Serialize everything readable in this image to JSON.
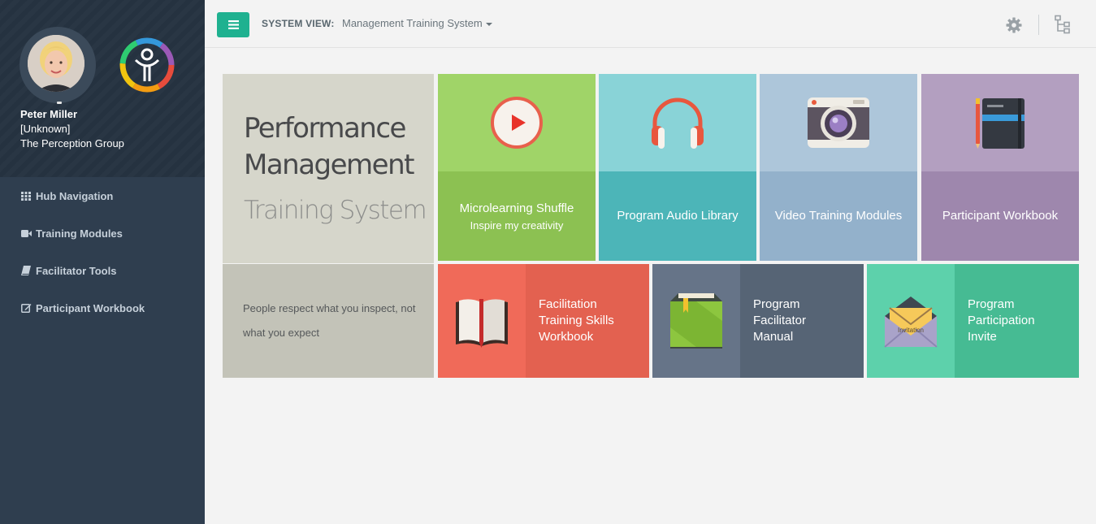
{
  "profile": {
    "name": "Peter Miller",
    "role": "[Unknown]",
    "organization": "The Perception Group"
  },
  "nav": [
    {
      "label": "Hub Navigation",
      "icon": "grid-icon"
    },
    {
      "label": "Training Modules",
      "icon": "video-camera-icon"
    },
    {
      "label": "Facilitator Tools",
      "icon": "book-icon"
    },
    {
      "label": "Participant Workbook",
      "icon": "edit-icon"
    }
  ],
  "header": {
    "system_label": "SYSTEM VIEW:",
    "system_value": "Management Training System"
  },
  "hero": {
    "title": "Performance Management",
    "subtitle": "Training System"
  },
  "quote": "People respect what you inspect, not what you expect",
  "tiles": [
    {
      "label": "Microlearning Shuffle",
      "sub": "Inspire my creativity",
      "icon": "play-button-icon"
    },
    {
      "label": "Program Audio Library",
      "sub": "",
      "icon": "headphones-icon"
    },
    {
      "label": "Video Training Modules",
      "sub": "",
      "icon": "camera-icon"
    },
    {
      "label": "Participant Workbook",
      "sub": "",
      "icon": "notebook-icon"
    }
  ],
  "wide_tiles": [
    {
      "lines": [
        "Facilitation",
        "Training Skills",
        "Workbook"
      ],
      "icon": "open-book-icon"
    },
    {
      "lines": [
        "Program",
        "Facilitator",
        "Manual"
      ],
      "icon": "manual-book-icon"
    },
    {
      "lines": [
        "Program",
        "Participation",
        "Invite"
      ],
      "icon": "invitation-envelope-icon"
    }
  ],
  "invitation_text": "Invitation",
  "colors": {
    "sidebar": "#2f3e4f",
    "accent": "#1fb190",
    "tile_green": "#8cc152",
    "tile_teal": "#4cb5b8",
    "tile_blue": "#93b1cb",
    "tile_purple": "#9e87ad",
    "tile_red": "#e36150",
    "tile_slate": "#566475",
    "tile_mint": "#46bb93"
  }
}
